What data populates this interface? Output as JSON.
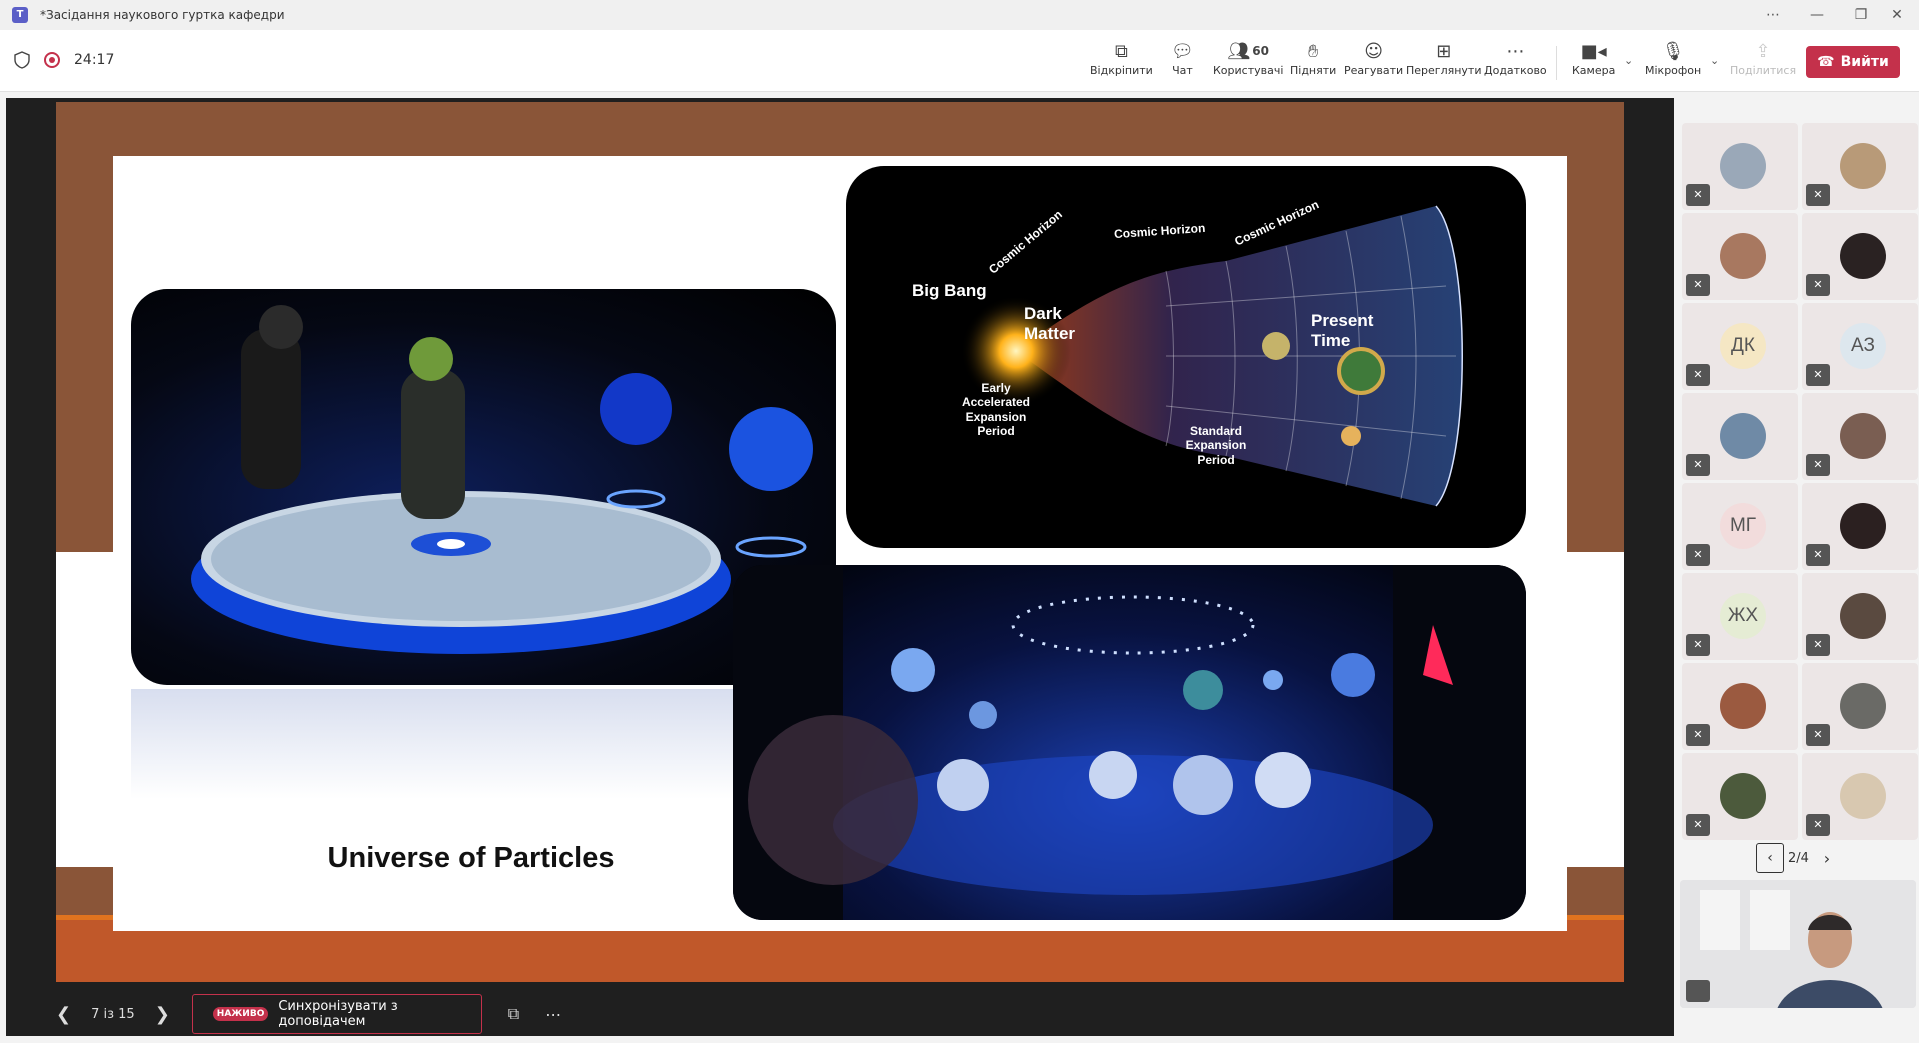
{
  "window": {
    "title": "*Засідання наукового гуртка кафедри",
    "app_icon": "teams-icon"
  },
  "toolbar": {
    "timer": "24:17",
    "buttons": [
      {
        "label": "Відкріпити",
        "icon": "unpin-icon"
      },
      {
        "label": "Чат",
        "icon": "chat-icon"
      },
      {
        "label": "Користувачі",
        "icon": "people-icon",
        "count": "60"
      },
      {
        "label": "Підняти",
        "icon": "raise-hand-icon"
      },
      {
        "label": "Реагувати",
        "icon": "react-icon"
      },
      {
        "label": "Переглянути",
        "icon": "view-icon"
      },
      {
        "label": "Додатково",
        "icon": "more-icon"
      },
      {
        "label": "Камера",
        "icon": "camera-icon"
      },
      {
        "label": "Мікрофон",
        "icon": "mic-off-icon"
      },
      {
        "label": "Поділитися",
        "icon": "share-icon",
        "disabled": true
      }
    ],
    "leave_label": "Вийти"
  },
  "slide": {
    "caption": "Universe of Particles",
    "diagram": {
      "big_bang": "Big Bang",
      "dark_matter": "Dark\nMatter",
      "present_time": "Present\nTime",
      "cosmic_horizon": "Cosmic Horizon",
      "early_period": "Early\nAccelerated\nExpansion\nPeriod",
      "standard_period": "Standard\nExpansion\nPeriod"
    }
  },
  "presenter_bar": {
    "page": "7 із 15",
    "live_badge": "НАЖИВО",
    "sync_label": "Синхронізувати з доповідачем"
  },
  "participants": {
    "tiles": [
      {
        "initials": "",
        "avatar": "photo",
        "color": "#9aa8b8"
      },
      {
        "initials": "",
        "avatar": "photo",
        "color": "#b89a78"
      },
      {
        "initials": "",
        "avatar": "photo",
        "color": "#a87860"
      },
      {
        "initials": "",
        "avatar": "photo",
        "color": "#2a2222"
      },
      {
        "initials": "ДК",
        "avatar": "initials",
        "color": "#f5e7c4"
      },
      {
        "initials": "АЗ",
        "avatar": "initials",
        "color": "#dde7ee"
      },
      {
        "initials": "",
        "avatar": "photo",
        "color": "#6f8aa6"
      },
      {
        "initials": "",
        "avatar": "photo",
        "color": "#7a5e52"
      },
      {
        "initials": "МГ",
        "avatar": "initials",
        "color": "#f2dcdc"
      },
      {
        "initials": "",
        "avatar": "photo",
        "color": "#2b2020"
      },
      {
        "initials": "ЖХ",
        "avatar": "initials",
        "color": "#e5ecd4"
      },
      {
        "initials": "",
        "avatar": "photo",
        "color": "#5a4a40"
      },
      {
        "initials": "",
        "avatar": "photo",
        "color": "#9b5a40"
      },
      {
        "initials": "",
        "avatar": "photo",
        "color": "#6a6a66"
      },
      {
        "initials": "",
        "avatar": "photo",
        "color": "#4c5a3c"
      },
      {
        "initials": "",
        "avatar": "photo",
        "color": "#d8c8b0"
      }
    ],
    "page_indicator": "2/4"
  }
}
